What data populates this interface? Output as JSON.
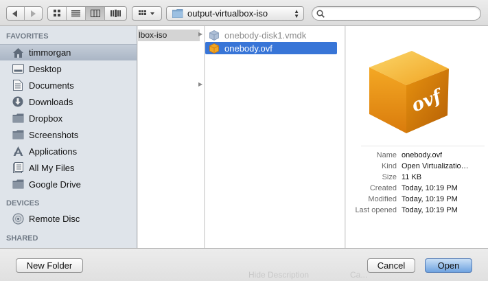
{
  "toolbar": {
    "path_label": "output-virtualbox-iso",
    "search_placeholder": ""
  },
  "sidebar": {
    "favorites_header": "FAVORITES",
    "devices_header": "DEVICES",
    "shared_header": "SHARED",
    "favorites": [
      {
        "label": "timmorgan",
        "icon": "home-icon",
        "selected": true
      },
      {
        "label": "Desktop",
        "icon": "desktop-icon"
      },
      {
        "label": "Documents",
        "icon": "documents-icon"
      },
      {
        "label": "Downloads",
        "icon": "downloads-icon"
      },
      {
        "label": "Dropbox",
        "icon": "folder-icon"
      },
      {
        "label": "Screenshots",
        "icon": "folder-icon"
      },
      {
        "label": "Applications",
        "icon": "applications-icon"
      },
      {
        "label": "All My Files",
        "icon": "all-files-icon"
      },
      {
        "label": "Google Drive",
        "icon": "folder-icon"
      }
    ],
    "devices": [
      {
        "label": "Remote Disc",
        "icon": "disc-icon"
      }
    ]
  },
  "columns": {
    "parent_item": "lbox-iso",
    "files": [
      {
        "name": "onebody-disk1.vmdk",
        "icon": "vmdk-icon",
        "selected": false
      },
      {
        "name": "onebody.ovf",
        "icon": "ovf-icon",
        "selected": true
      }
    ]
  },
  "preview": {
    "icon_text": "ovf",
    "info": [
      {
        "key": "Name",
        "value": "onebody.ovf"
      },
      {
        "key": "Kind",
        "value": "Open Virtualizatio…"
      },
      {
        "key": "Size",
        "value": "11 KB"
      },
      {
        "key": "Created",
        "value": "Today, 10:19 PM"
      },
      {
        "key": "Modified",
        "value": "Today, 10:19 PM"
      },
      {
        "key": "Last opened",
        "value": "Today, 10:19 PM"
      }
    ]
  },
  "bottom": {
    "new_folder": "New Folder",
    "cancel": "Cancel",
    "open": "Open",
    "ghost_left": "Hide Description",
    "ghost_right": "Ca..."
  },
  "colors": {
    "selection": "#3875d7",
    "sidebar_bg": "#dfe4ea"
  }
}
